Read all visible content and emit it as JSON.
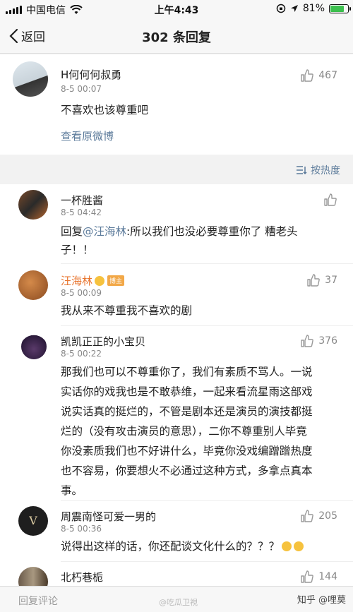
{
  "status_bar": {
    "carrier": "中国电信",
    "time": "上午4:43",
    "battery": "81%",
    "battery_level": 0.81,
    "battery_color": "#3cc04e"
  },
  "nav": {
    "back_label": "返回",
    "title": "302 条回复"
  },
  "main_post": {
    "user": "H何何何叔勇",
    "time": "8-5 00:07",
    "likes": "467",
    "text": "不喜欢也该尊重吧",
    "link": "查看原微博"
  },
  "sort": {
    "label": "按热度"
  },
  "comments": [
    {
      "user": "一杯胜酱",
      "time": "8-5 04:42",
      "likes": "",
      "reply_prefix": "回复",
      "mention": "@汪海林",
      "text_line1": ":所以我们也没必要尊重你了 糟老头",
      "text_line2": "子！！"
    },
    {
      "user": "汪海林",
      "badge": "博主",
      "time": "8-5 00:09",
      "likes": "37",
      "text": "我从来不尊重我不喜欢的剧"
    },
    {
      "user": "凯凯正正的小宝贝",
      "time": "8-5 00:22",
      "likes": "376",
      "lines": [
        "那我们也可以不尊重你了，我们有素质不骂人。一说",
        "实话你的戏我也是不敢恭维，一起来看流星雨这部戏",
        "说实话真的挺烂的，不管是剧本还是演员的演技都挺",
        "烂的（没有攻击演员的意思），二你不尊重别人毕竟",
        "你没素质我们也不好讲什么，毕竟你没戏编蹭蹭热度",
        "也不容易，你要想火不必通过这种方式，多拿点真本",
        "事。"
      ]
    },
    {
      "user": "周震南怪可爱一男的",
      "time": "8-5 00:36",
      "likes": "205",
      "text": "说得出这样的话，你还配谈文化什么的？？？"
    },
    {
      "user": "北朽巷栀",
      "likes": "144"
    }
  ],
  "reply_bar": {
    "placeholder": "回复评论",
    "watermark": "知乎 @哩莫",
    "watermark2": "@吃瓜卫視"
  },
  "colors": {
    "link": "#5b7a9a",
    "vip_name": "#e8742d",
    "badge": "#f2a848"
  }
}
